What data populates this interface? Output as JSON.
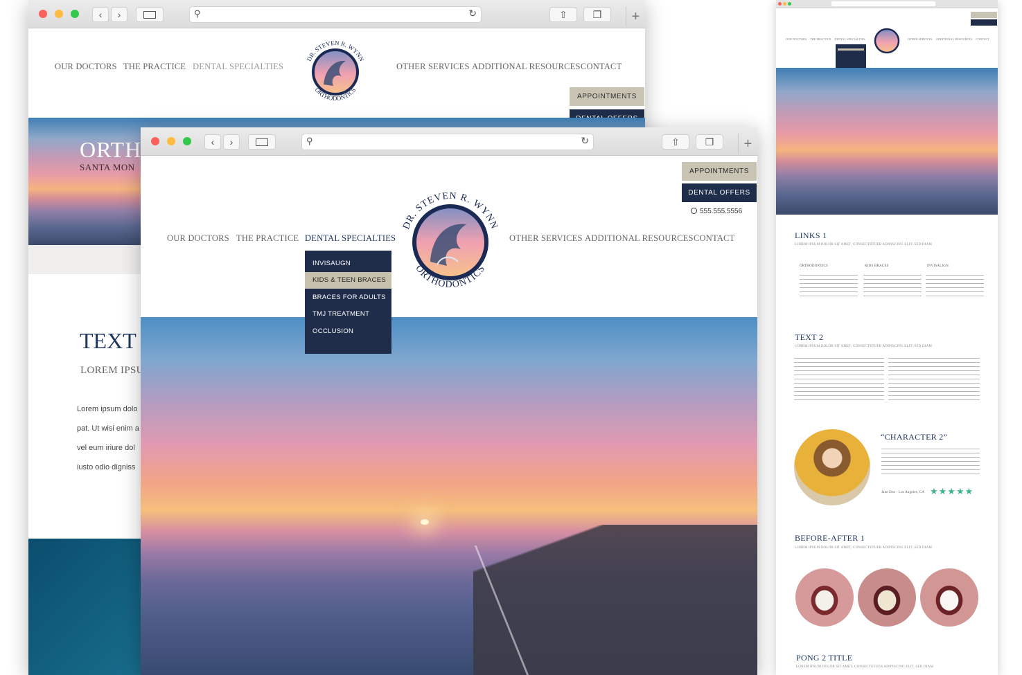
{
  "logo": {
    "top_text": "DR. STEVEN R. WYNN",
    "bottom_text": "ORTHODONTICS"
  },
  "nav": {
    "left": [
      "OUR DOCTORS",
      "THE PRACTICE",
      "DENTAL SPECIALTIES"
    ],
    "right": [
      "OTHER SERVICES",
      "ADDITIONAL RESOURCES",
      "CONTACT"
    ]
  },
  "cta": {
    "appointments": "APPOINTMENTS",
    "offers": "DENTAL OFFERS",
    "phone": "555.555.5556"
  },
  "dropdown": {
    "items": [
      "INVISAUGN",
      "KIDS & TEEN BRACES",
      "BRACES FOR ADULTS",
      "TMJ TREATMENT",
      "OCCLUSION"
    ],
    "active_index": 1
  },
  "back_window": {
    "hero_title": "ORTH",
    "hero_sub": "SANTA MON",
    "text_title": "TEXT",
    "text_sub": "LOREM IPSU",
    "para": [
      "Lorem ipsum dolo",
      "pat. Ut wisi enim a",
      "vel eum iriure dol",
      "iusto odio digniss"
    ]
  },
  "right_preview": {
    "links_title": "LINKS 1",
    "lorem_caps": "LOREM IPSUM DOLOR SIT AMET, CONSECTETUER ADIPISCING ELIT, SED DIAM",
    "columns": [
      "ORTHODONTICS",
      "KIDS BRACES",
      "INVISALIGN"
    ],
    "text2_title": "TEXT 2",
    "testimonial_title": "“CHARACTER 2”",
    "testimonial_author": "Jane Doe - Los Angeles, CA",
    "stars": 5,
    "before_after_title": "BEFORE-AFTER 1",
    "pong_title": "PONG 2 TITLE"
  },
  "colors": {
    "navy": "#1f2d4b",
    "accent_beige": "#c9c3b4",
    "title_blue": "#1f3760",
    "star_green": "#3fb58c"
  }
}
